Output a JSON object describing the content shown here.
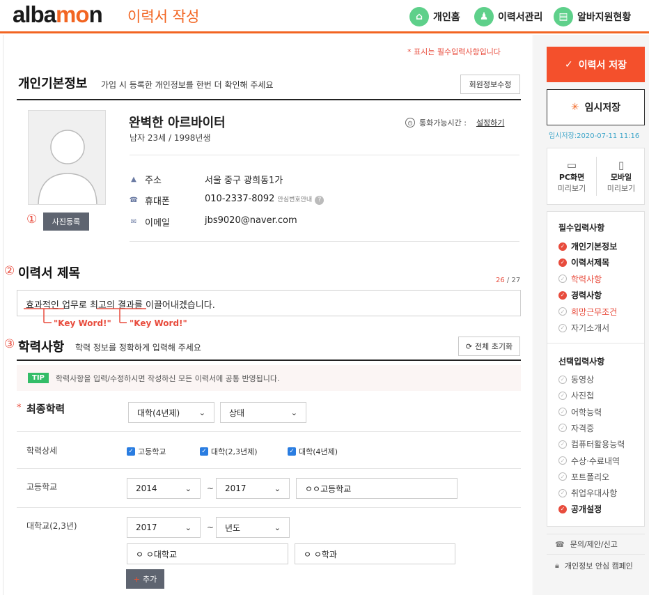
{
  "header": {
    "logo": "albamon",
    "page_title": "이력서 작성",
    "nav": [
      {
        "label": "개인홈",
        "icon": "home-icon"
      },
      {
        "label": "이력서관리",
        "icon": "person-add-icon"
      },
      {
        "label": "알바지원현황",
        "icon": "clipboard-icon"
      }
    ]
  },
  "required_note": "* 표시는 필수입력사항입니다",
  "personal": {
    "title": "개인기본정보",
    "subtitle": "가입 시 등록한 개인정보를 한번 더 확인해 주세요",
    "edit_button": "회원정보수정",
    "photo_button": "사진등록",
    "photo_marker": "①",
    "name": "완벽한 아르바이터",
    "meta": "남자 23세 / 1998년생",
    "call_label": "통화가능시간 :",
    "call_link": "설정하기",
    "address_label": "주소",
    "address_value": "서울 중구 광희동1가",
    "phone_label": "휴대폰",
    "phone_value": "010-2337-8092",
    "phone_note": "안심번호안내",
    "email_label": "이메일",
    "email_value": "jbs9020@naver.com"
  },
  "resume_title": {
    "marker": "②",
    "title": "이력서 제목",
    "count_current": "26",
    "count_sep": " / ",
    "count_max": "27",
    "value": "효과적인 업무로 최고의 결과를 이끌어내겠습니다.",
    "keyword1": "\"Key Word!\"",
    "keyword2": "\"Key Word!\""
  },
  "education": {
    "marker": "③",
    "title": "학력사항",
    "subtitle": "학력 정보를 정확하게 입력해 주세요",
    "reset_button": "전체 초기화",
    "tip_badge": "TIP",
    "tip_text": "학력사항을 입력/수정하시면 작성하신 모든 이력서에 공통 반영됩니다.",
    "final_label": "최종학력",
    "final_select": "대학(4년제)",
    "status_select": "상태",
    "detail_label": "학력상세",
    "checks": [
      "고등학교",
      "대학(2,3년제)",
      "대학(4년제)"
    ],
    "hs_label": "고등학교",
    "hs_from": "2014",
    "hs_to": "2017",
    "hs_name": "ㅇㅇ고등학교",
    "tilde": "~",
    "uni_label": "대학교(2,3년)",
    "uni_from": "2017",
    "uni_to": "년도",
    "uni_name": "ㅇ ㅇ대학교",
    "uni_major": "ㅇ ㅇ학과",
    "add_button": "추가"
  },
  "sidebar": {
    "save_button": "이력서 저장",
    "temp_button": "임시저장",
    "temp_note": "임시저장:2020-07-11 11:16",
    "pc_preview_1": "PC화면",
    "pc_preview_2": "미리보기",
    "mobile_preview_1": "모바일",
    "mobile_preview_2": "미리보기",
    "required_title": "필수입력사항",
    "required_items": [
      {
        "label": "개인기본정보",
        "done": true,
        "highlight": false
      },
      {
        "label": "이력서제목",
        "done": true,
        "highlight": false
      },
      {
        "label": "학력사항",
        "done": false,
        "highlight": true
      },
      {
        "label": "경력사항",
        "done": true,
        "highlight": false
      },
      {
        "label": "희망근무조건",
        "done": false,
        "highlight": true
      },
      {
        "label": "자기소개서",
        "done": false,
        "highlight": false
      }
    ],
    "optional_title": "선택입력사항",
    "optional_items": [
      {
        "label": "동영상",
        "done": false
      },
      {
        "label": "사진첩",
        "done": false
      },
      {
        "label": "어학능력",
        "done": false
      },
      {
        "label": "자격증",
        "done": false
      },
      {
        "label": "컴퓨터활용능력",
        "done": false
      },
      {
        "label": "수상·수료내역",
        "done": false
      },
      {
        "label": "포트폴리오",
        "done": false
      },
      {
        "label": "취업우대사항",
        "done": false
      },
      {
        "label": "공개설정",
        "done": true
      }
    ],
    "footer_links": [
      "문의/제안/신고",
      "개인정보 안심 캠페인"
    ]
  },
  "colors": {
    "accent": "#f26522",
    "required": "#e84c3d",
    "save": "#f4502c",
    "tip": "#33bd68"
  }
}
